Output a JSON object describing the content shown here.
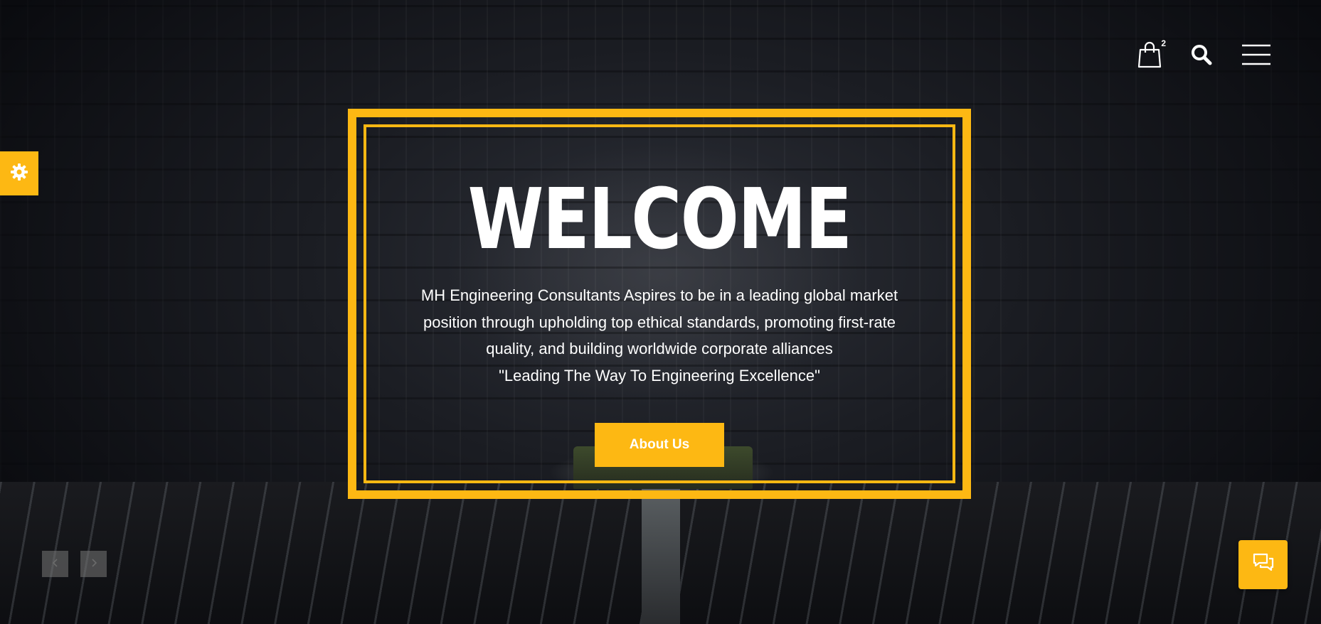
{
  "header": {
    "cart_count": "2",
    "icons": [
      "shopping-bag-icon",
      "search-icon",
      "hamburger-menu-icon"
    ]
  },
  "settings": {
    "icon": "gear-icon"
  },
  "hero": {
    "title": "WELCOME",
    "description": "MH Engineering Consultants Aspires to be in a leading global market position through upholding top ethical standards, promoting first-rate quality, and building worldwide corporate alliances",
    "tagline": "\"Leading The Way To Engineering Excellence\"",
    "button_label": "About Us"
  },
  "slider": {
    "prev_icon": "chevron-left-icon",
    "next_icon": "chevron-right-icon"
  },
  "chat": {
    "icon": "chat-bubbles-icon"
  },
  "colors": {
    "accent": "#fdb813",
    "text": "#ffffff",
    "background": "#0b0d12"
  }
}
